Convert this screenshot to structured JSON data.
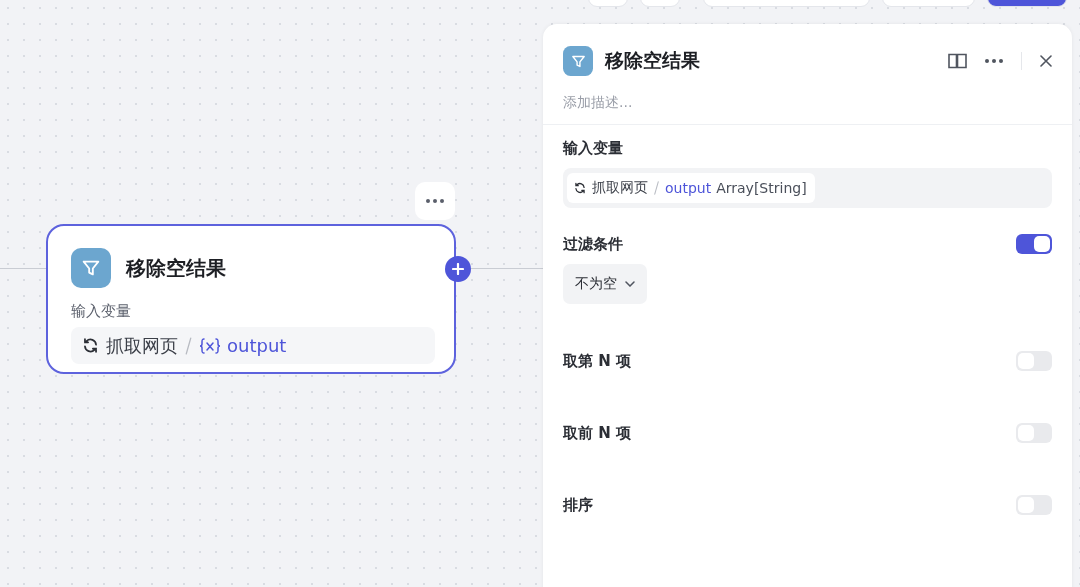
{
  "toolbar": [
    {
      "kind": "small"
    },
    {
      "kind": "small"
    },
    {
      "kind": "wide"
    },
    {
      "kind": "medium"
    },
    {
      "kind": "primary"
    }
  ],
  "node": {
    "title": "移除空结果",
    "input_label": "输入变量",
    "variable": {
      "source": "抓取网页",
      "name": "output"
    }
  },
  "panel": {
    "title": "移除空结果",
    "description_placeholder": "添加描述...",
    "input_label": "输入变量",
    "variable": {
      "source": "抓取网页",
      "name": "output",
      "type": "Array[String]"
    },
    "filter": {
      "label": "过滤条件",
      "on": true,
      "condition": "不为空"
    },
    "options": [
      {
        "label": "取第 N 项",
        "on": false
      },
      {
        "label": "取前 N 项",
        "on": false
      },
      {
        "label": "排序",
        "on": false
      }
    ]
  }
}
